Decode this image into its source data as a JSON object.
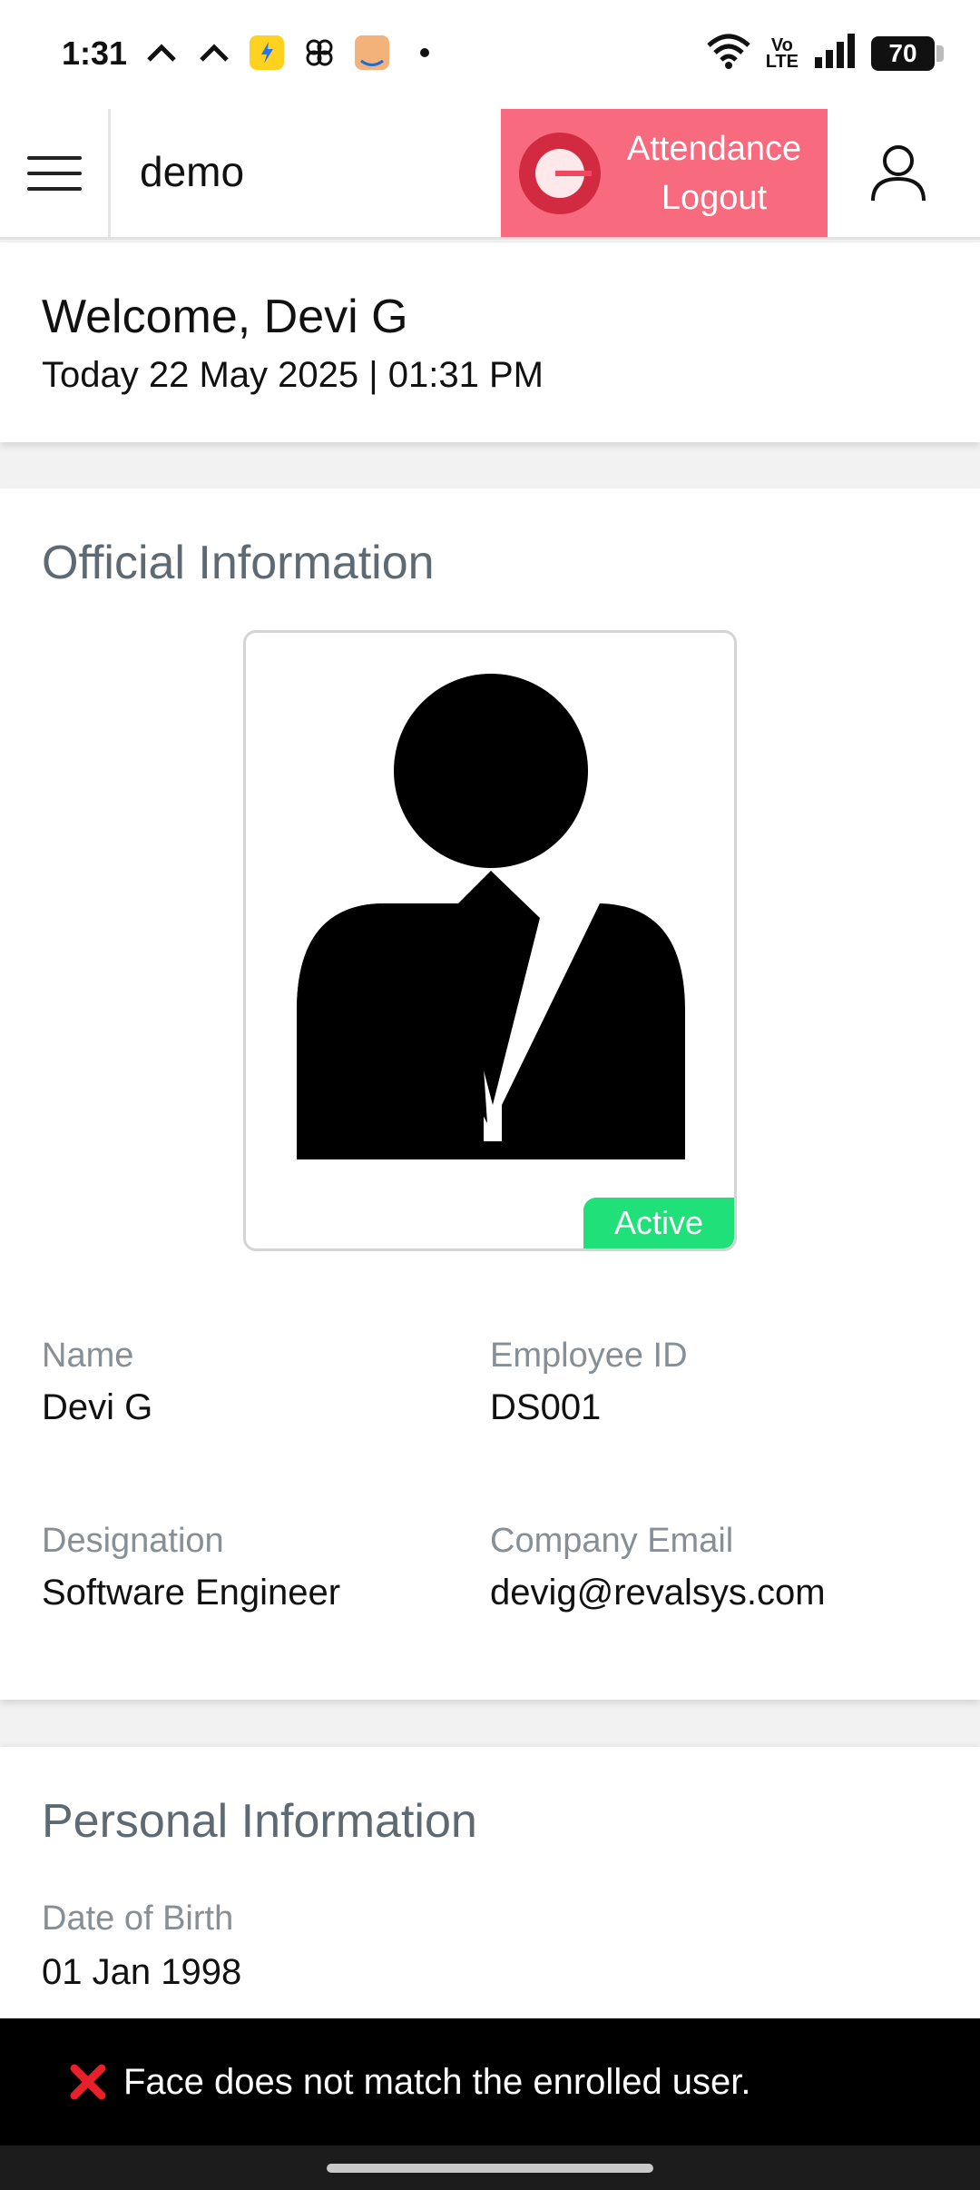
{
  "status_bar": {
    "time": "1:31",
    "network_label": "Vo\nLTE",
    "battery": "70",
    "icons": [
      "chevron-up-icon",
      "chevron-up-icon",
      "flipkart-icon",
      "pinwheel-icon",
      "amazon-icon",
      "dot-icon",
      "wifi-icon",
      "signal-icon",
      "battery-icon"
    ]
  },
  "app_bar": {
    "title": "demo",
    "attendance_line1": "Attendance",
    "attendance_line2": "Logout",
    "accent_color": "#f86a7d",
    "icons": [
      "menu-icon",
      "attendance-logout-icon",
      "user-profile-icon"
    ]
  },
  "welcome": {
    "title": "Welcome, Devi G",
    "date": "Today 22 May 2025 | 01:31 PM"
  },
  "official": {
    "title": "Official Information",
    "status": "Active",
    "status_color": "#20e07a",
    "fields": [
      {
        "label": "Name",
        "value": "Devi G"
      },
      {
        "label": "Employee ID",
        "value": "DS001"
      },
      {
        "label": "Designation",
        "value": "Software Engineer"
      },
      {
        "label": "Company Email",
        "value": "devig@revalsys.com"
      }
    ]
  },
  "personal": {
    "title": "Personal Information",
    "fields": [
      {
        "label": "Date of Birth",
        "value": "01 Jan 1998"
      }
    ]
  },
  "snackbar": {
    "message": "Face does not match the enrolled user.",
    "icon": "error-x-icon"
  }
}
